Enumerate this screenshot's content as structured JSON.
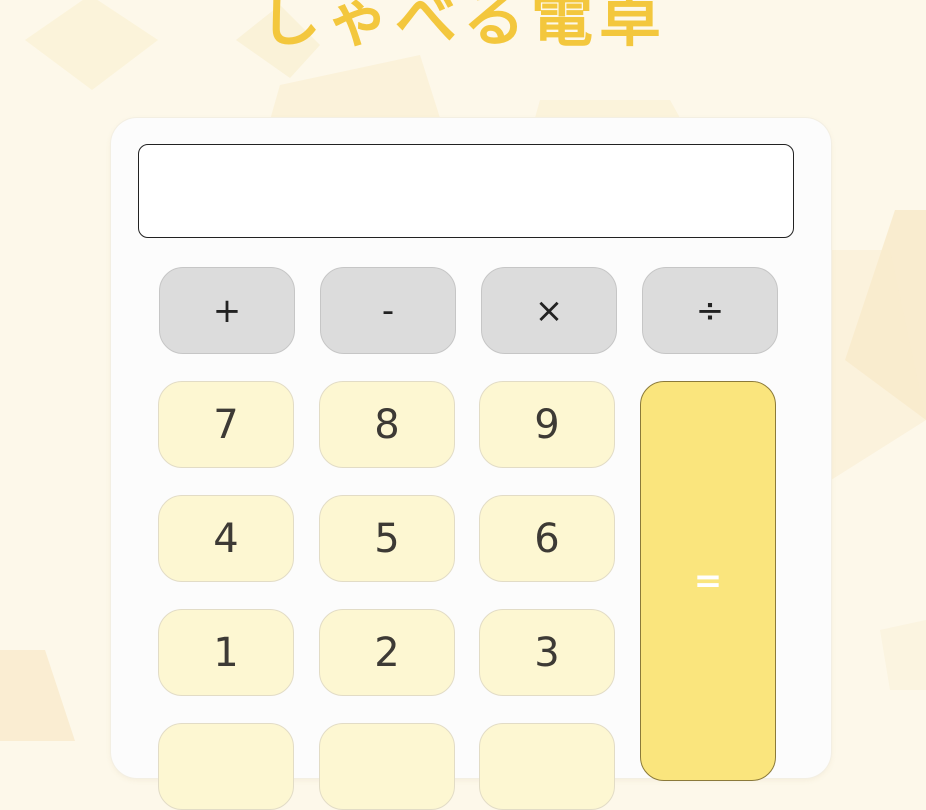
{
  "app": {
    "title": "しゃべる電卓"
  },
  "display": {
    "value": ""
  },
  "operators": [
    "+",
    "-",
    "×",
    "÷"
  ],
  "digits": {
    "row1": [
      "7",
      "8",
      "9"
    ],
    "row2": [
      "4",
      "5",
      "6"
    ],
    "row3": [
      "1",
      "2",
      "3"
    ]
  },
  "equals_label": "=",
  "colors": {
    "background": "#fdf8ea",
    "title": "#f3c73d",
    "operator_key": "#dcdcdc",
    "digit_key": "#fdf7d2",
    "equals_key": "#fae57d"
  }
}
